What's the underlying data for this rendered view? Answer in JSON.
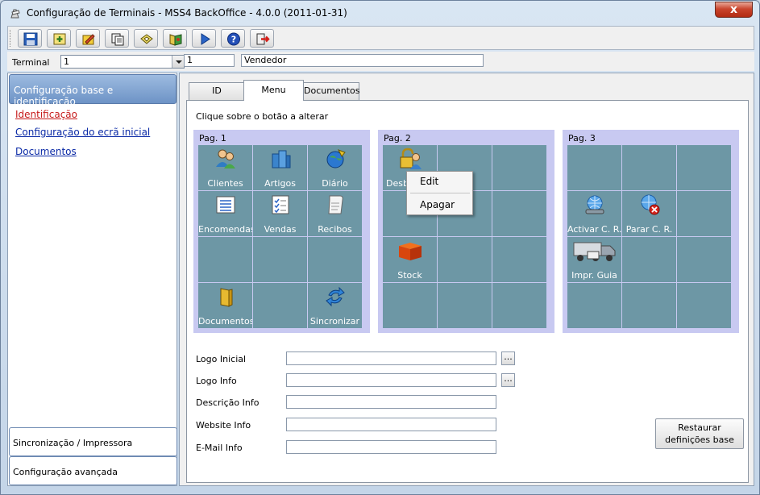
{
  "window": {
    "title": "Configuração de Terminais - MSS4 BackOffice - 4.0.0 (2011-01-31)",
    "close_label": "x"
  },
  "toolbar": {
    "buttons": [
      {
        "icon": "save-icon"
      },
      {
        "icon": "add-icon"
      },
      {
        "icon": "edit-icon"
      },
      {
        "icon": "copy-icon"
      },
      {
        "icon": "print-icon"
      },
      {
        "icon": "book-icon"
      },
      {
        "icon": "play-icon"
      },
      {
        "icon": "help-icon"
      },
      {
        "icon": "exit-icon"
      }
    ]
  },
  "terminal": {
    "label": "Terminal",
    "selected": "1",
    "code": "1",
    "name": "Vendedor"
  },
  "sidebar": {
    "header": "Configuração base e identificação",
    "links": [
      "Identificação",
      "Configuração do ecrã inicial",
      "Documentos"
    ],
    "sections": [
      "Sincronização / Impressora",
      "Configuração avançada"
    ]
  },
  "tabs": [
    "ID",
    "Menu",
    "Documentos"
  ],
  "menu": {
    "hint": "Clique sobre o botão a alterar",
    "pages": [
      {
        "title": "Pag. 1",
        "cells": [
          {
            "label": "Clientes",
            "icon": "users-icon"
          },
          {
            "label": "Artigos",
            "icon": "products-icon"
          },
          {
            "label": "Diário",
            "icon": "globe-icon"
          },
          {
            "label": "Encomendas",
            "icon": "list-icon"
          },
          {
            "label": "Vendas",
            "icon": "checklist-icon"
          },
          {
            "label": "Recibos",
            "icon": "receipt-icon"
          },
          {
            "label": "",
            "icon": ""
          },
          {
            "label": "",
            "icon": ""
          },
          {
            "label": "",
            "icon": ""
          },
          {
            "label": "Documentos",
            "icon": "folder-icon"
          },
          {
            "label": "",
            "icon": ""
          },
          {
            "label": "Sincronizar",
            "icon": "sync-icon"
          }
        ]
      },
      {
        "title": "Pag. 2",
        "cells": [
          {
            "label": "Desb",
            "icon": "unlock-user-icon"
          },
          {
            "label": "",
            "icon": ""
          },
          {
            "label": "",
            "icon": ""
          },
          {
            "label": "",
            "icon": ""
          },
          {
            "label": "",
            "icon": ""
          },
          {
            "label": "",
            "icon": ""
          },
          {
            "label": "Stock",
            "icon": "box-icon"
          },
          {
            "label": "",
            "icon": ""
          },
          {
            "label": "",
            "icon": ""
          },
          {
            "label": "",
            "icon": ""
          },
          {
            "label": "",
            "icon": ""
          },
          {
            "label": "",
            "icon": ""
          }
        ]
      },
      {
        "title": "Pag. 3",
        "cells": [
          {
            "label": "",
            "icon": ""
          },
          {
            "label": "",
            "icon": ""
          },
          {
            "label": "",
            "icon": ""
          },
          {
            "label": "Activar C. R.",
            "icon": "network-on-icon"
          },
          {
            "label": "Parar C. R.",
            "icon": "network-off-icon"
          },
          {
            "label": "",
            "icon": ""
          },
          {
            "label": "Impr. Guia",
            "icon": "truck-icon"
          },
          {
            "label": "",
            "icon": ""
          },
          {
            "label": "",
            "icon": ""
          },
          {
            "label": "",
            "icon": ""
          },
          {
            "label": "",
            "icon": ""
          },
          {
            "label": "",
            "icon": ""
          }
        ]
      }
    ],
    "context_menu": [
      "Edit",
      "Apagar"
    ]
  },
  "form": {
    "logo_inicial": {
      "label": "Logo Inicial",
      "value": ""
    },
    "logo_info": {
      "label": "Logo Info",
      "value": ""
    },
    "descricao_info": {
      "label": "Descrição Info",
      "value": ""
    },
    "website_info": {
      "label": "Website Info",
      "value": ""
    },
    "email_info": {
      "label": "E-Mail Info",
      "value": ""
    },
    "browse_label": "...",
    "restore_label": "Restaurar definições base"
  }
}
